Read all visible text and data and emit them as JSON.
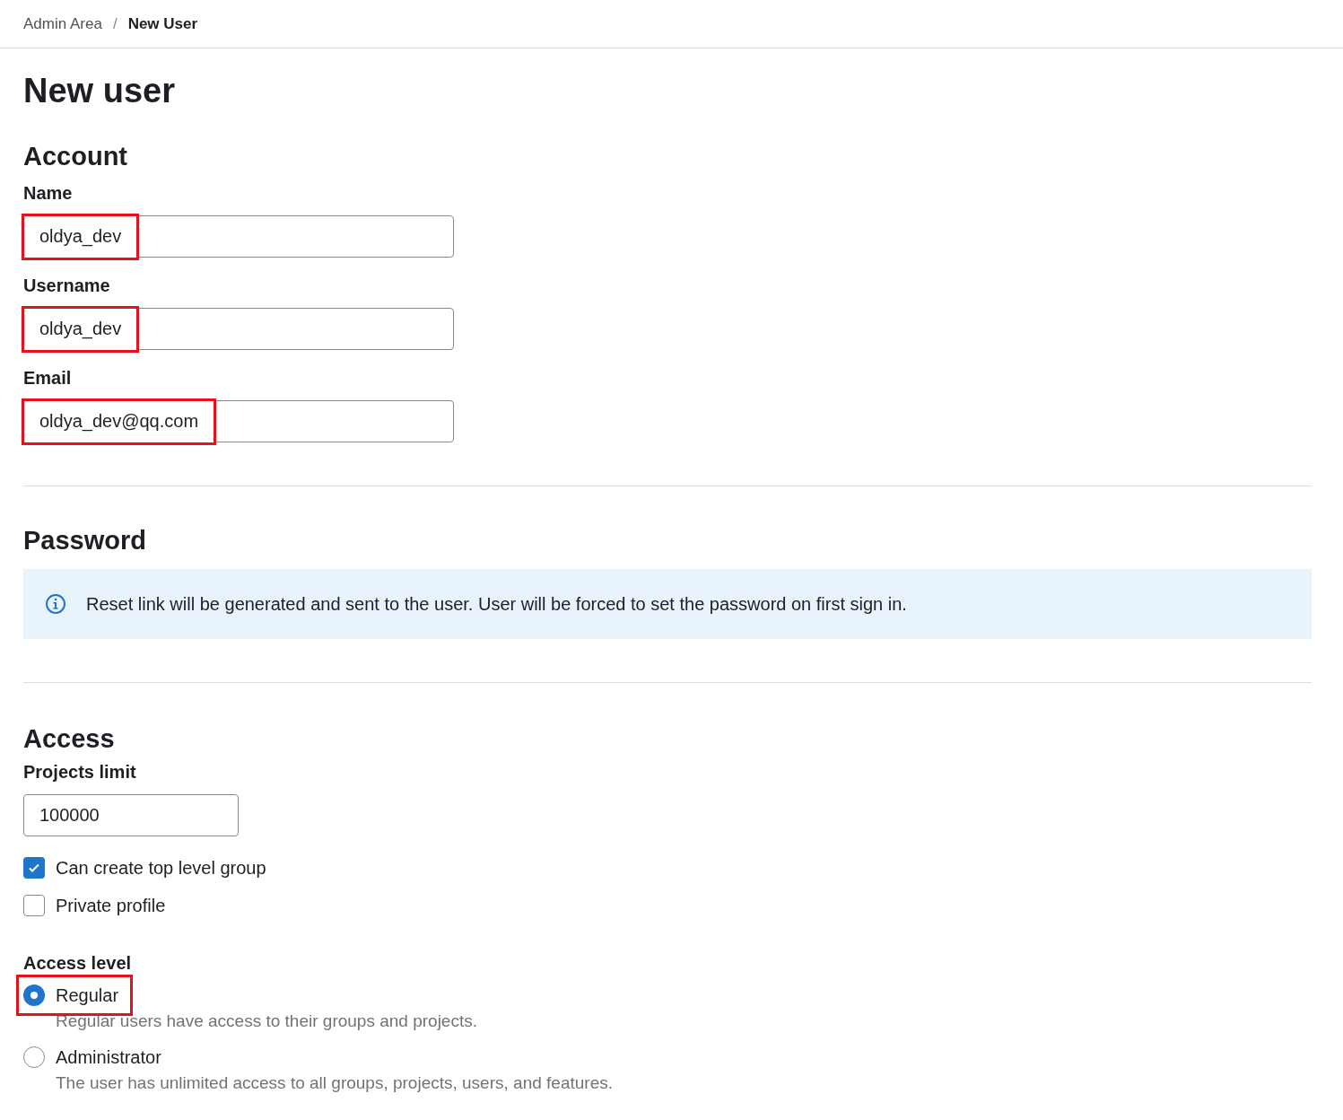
{
  "breadcrumb": [
    {
      "label": "Admin Area",
      "current": false
    },
    {
      "separator": "/",
      "label": "New User",
      "current": true
    }
  ],
  "title": "New user",
  "account": {
    "heading": "Account",
    "fields": [
      {
        "label": "Name",
        "value": "oldya_dev",
        "highlighted": true
      },
      {
        "label": "Username",
        "value": "oldya_dev",
        "highlighted": true
      },
      {
        "label": "Email",
        "value": "oldya_dev@qq.com",
        "highlighted": true
      }
    ]
  },
  "password": {
    "heading": "Password",
    "alert": "Reset link will be generated and sent to the user. User will be forced to set the password on first sign in."
  },
  "access": {
    "heading": "Access",
    "projects_limit": {
      "label": "Projects limit",
      "value": "100000"
    },
    "checkboxes": [
      {
        "label": "Can create top level group",
        "checked": true
      },
      {
        "label": "Private profile",
        "checked": false
      }
    ],
    "access_level": {
      "label": "Access level",
      "options": [
        {
          "label": "Regular",
          "help": "Regular users have access to their groups and projects.",
          "selected": true,
          "highlighted": true
        },
        {
          "label": "Administrator",
          "help": "The user has unlimited access to all groups, projects, users, and features.",
          "selected": false,
          "highlighted": false
        }
      ]
    }
  }
}
